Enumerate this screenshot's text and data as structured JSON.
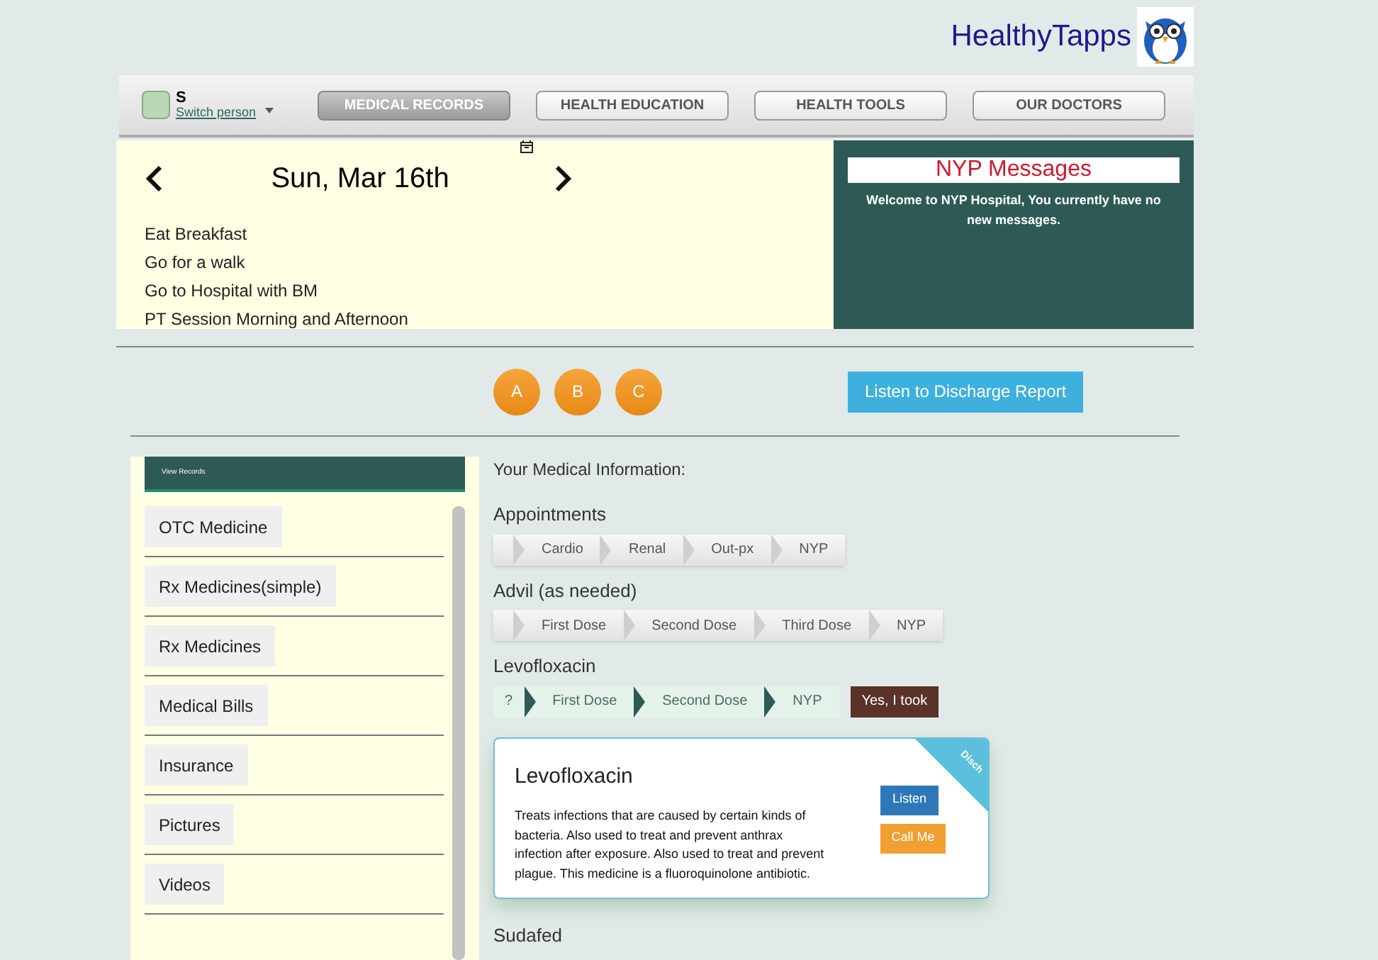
{
  "brand": {
    "name": "HealthyTapps"
  },
  "user": {
    "initial": "S",
    "switch_label": "Switch person"
  },
  "nav_tabs": [
    {
      "label": "MEDICAL RECORDS",
      "selected": true
    },
    {
      "label": "HEALTH EDUCATION",
      "selected": false
    },
    {
      "label": "HEALTH TOOLS",
      "selected": false
    },
    {
      "label": "OUR DOCTORS",
      "selected": false
    }
  ],
  "schedule": {
    "date": "Sun, Mar 16th",
    "items": [
      "Eat Breakfast",
      "Go for a walk",
      "Go to Hospital with BM",
      "PT Session Morning and Afternoon"
    ]
  },
  "messages": {
    "title": "NYP Messages",
    "body": "Welcome to NYP Hospital, You currently have no new messages."
  },
  "circle_buttons": [
    "A",
    "B",
    "C"
  ],
  "discharge_button": "Listen to Discharge Report",
  "sidebar": {
    "header": "View Records",
    "items": [
      "OTC Medicine",
      "Rx Medicines(simple)",
      "Rx Medicines",
      "Medical Bills",
      "Insurance",
      "Pictures",
      "Videos"
    ]
  },
  "content": {
    "heading": "Your Medical Information:",
    "trackers": [
      {
        "title": "Appointments",
        "kind": "plain",
        "steps": [
          "Cardio",
          "Renal",
          "Out-px",
          "NYP"
        ]
      },
      {
        "title": "Advil (as needed)",
        "kind": "plain",
        "steps": [
          "First Dose",
          "Second Dose",
          "Third Dose",
          "NYP"
        ]
      },
      {
        "title": "Levofloxacin",
        "kind": "current",
        "lead": "?",
        "steps": [
          "First Dose",
          "Second Dose",
          "NYP"
        ],
        "action": "Yes, I took"
      }
    ],
    "card": {
      "title": "Levofloxacin",
      "ribbon": "Disch",
      "text": "Treats infections that are caused by certain kinds of bacteria. Also used to treat and prevent anthrax infection after exposure. Also used to treat and prevent plague. This medicine is a fluoroquinolone antibiotic.",
      "buttons": [
        "Listen",
        "Call Me"
      ]
    },
    "next_title": "Sudafed"
  }
}
